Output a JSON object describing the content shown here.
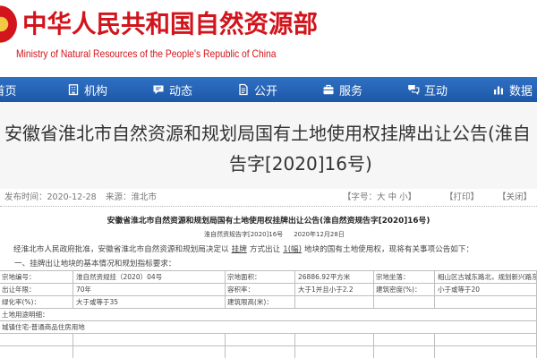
{
  "theme": {
    "brand_red": "#d2141c",
    "nav_blue_top": "#2f70c4",
    "nav_blue_bottom": "#1d58a8"
  },
  "header": {
    "emblem_icon": "national-emblem-icon",
    "title_cn": "中华人民共和国自然资源部",
    "title_en": "Ministry of Natural Resources of the People's Republic of China"
  },
  "nav": {
    "items": [
      {
        "label": "首页",
        "icon": "home-icon"
      },
      {
        "label": "机构",
        "icon": "building-icon"
      },
      {
        "label": "动态",
        "icon": "news-icon"
      },
      {
        "label": "公开",
        "icon": "disclosure-icon"
      },
      {
        "label": "服务",
        "icon": "service-icon"
      },
      {
        "label": "互动",
        "icon": "interaction-icon"
      },
      {
        "label": "数据",
        "icon": "data-chart-icon"
      }
    ]
  },
  "article": {
    "title_line1": "安徽省淮北市自然资源和规划局国有土地使用权挂牌出让公告(淮自",
    "title_line2": "告字[2020]16号)",
    "meta": {
      "date": "发布时间：2020-12-28",
      "source": "来源：淮北市",
      "font_size": {
        "prefix": "【字号：",
        "large": "大",
        "medium": "中",
        "small": "小",
        "suffix": "】"
      },
      "print": "【打印】",
      "close": "【关闭】"
    }
  },
  "document": {
    "heading": "安徽省淮北市自然资源和规划局国有土地使用权挂牌出让公告(淮自然资规告字[2020]16号)",
    "doc_number": "淮自然资规告字[2020]16号",
    "doc_date": "2020年12月28日",
    "intro": {
      "before": "经淮北市人民政府批准，安徽省淮北市自然资源和规划局决定以",
      "method": "挂牌",
      "mid": "方式出让",
      "count": "1(幅)",
      "after": "地块的国有土地使用权，现将有关事项公告如下："
    },
    "section1": "一、挂牌出让地块的基本情况和规划指标要求：",
    "table_rows": [
      [
        "宗地编号：",
        "淮自然资规挂（2020）04号",
        "宗地面积：",
        "26886.92平方米",
        "宗地坐落：",
        "相山区古城东路北，规划新兴路东"
      ],
      [
        "出让年限：",
        "70年",
        "容积率：",
        "大于1并且小于2.2",
        "建筑密度(%)：",
        "小于或等于20"
      ],
      [
        "绿化率(%)：",
        "大于或等于35",
        "建筑限高(米)："
      ],
      [
        "土地用途明细："
      ],
      [
        "城镇住宅-普通商品住房用地"
      ]
    ]
  }
}
